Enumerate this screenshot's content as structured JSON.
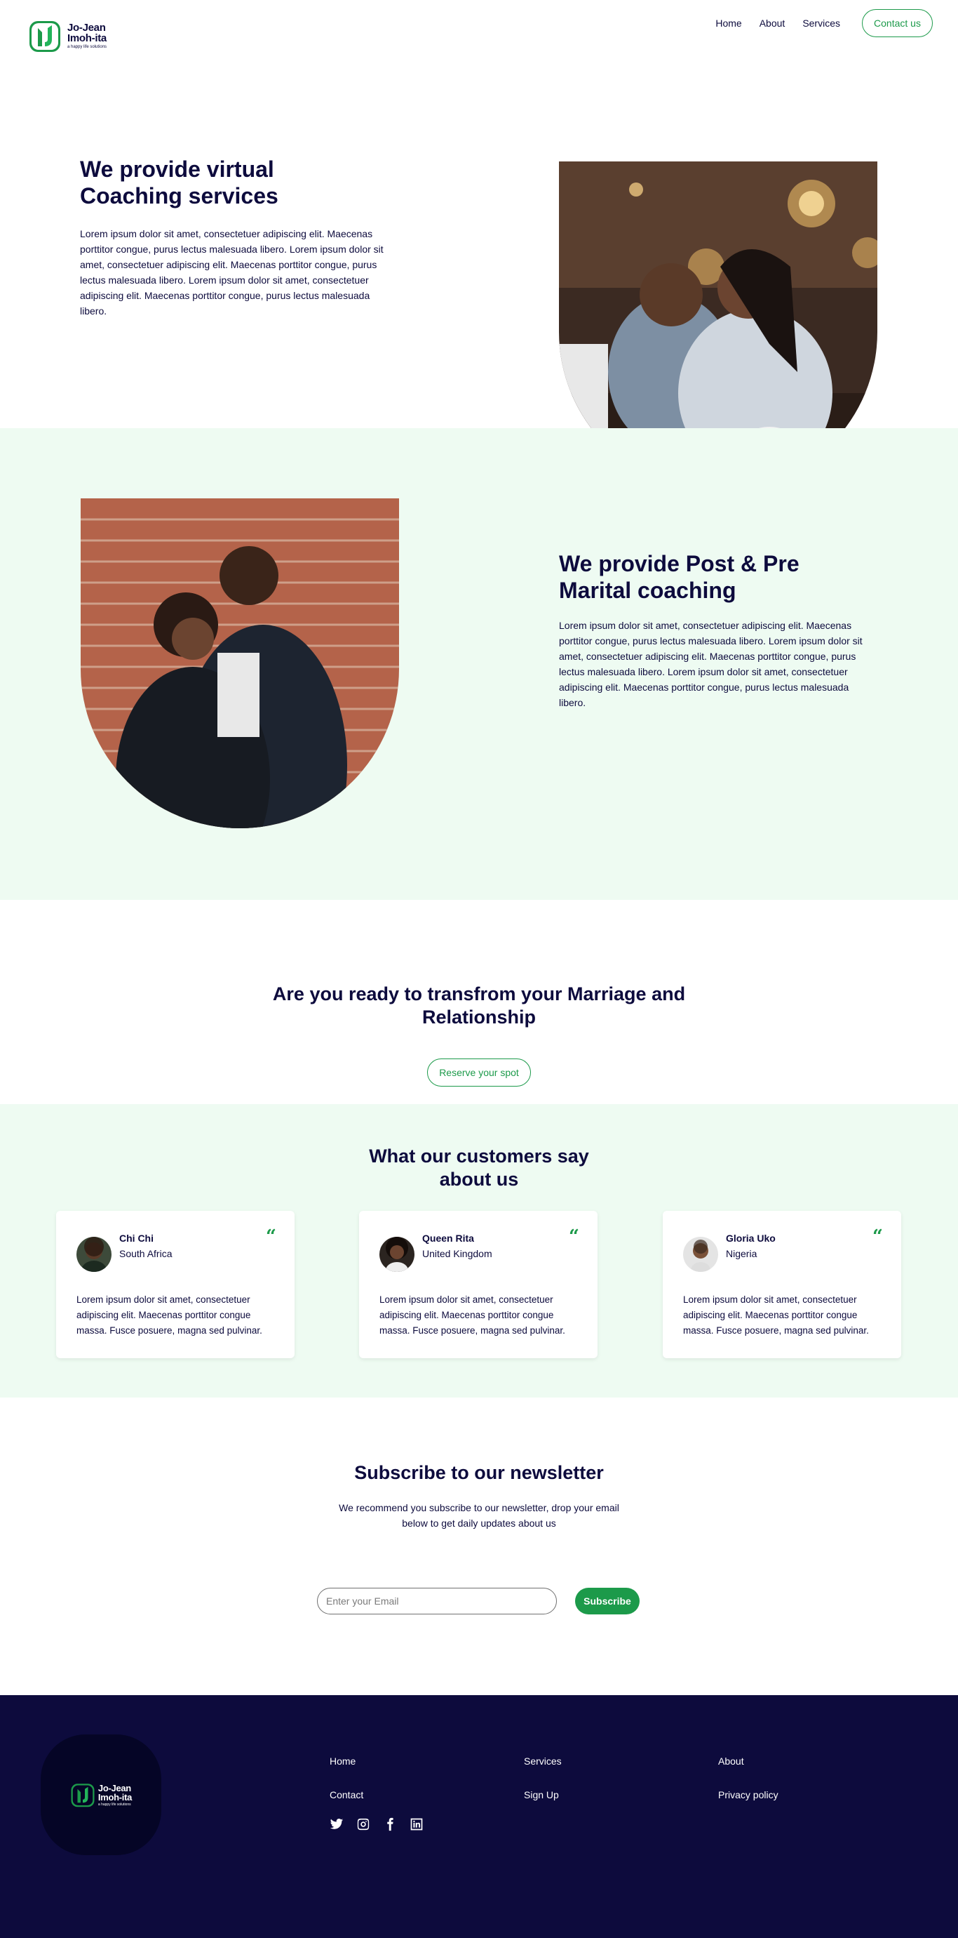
{
  "brand": {
    "name_line1": "Jo-Jean",
    "name_line2": "Imoh-ita",
    "tagline": "a happy life solutions"
  },
  "nav": {
    "items": [
      {
        "label": "Home"
      },
      {
        "label": "About"
      },
      {
        "label": "Services"
      }
    ],
    "contact_label": "Contact us"
  },
  "section1": {
    "title_line1": "We provide virtual",
    "title_line2": "Coaching services",
    "body": "Lorem ipsum dolor sit amet, consectetuer adipiscing elit. Maecenas porttitor congue, purus lectus malesuada libero. Lorem ipsum dolor sit amet, consectetuer adipiscing elit. Maecenas porttitor congue, purus lectus malesuada libero. Lorem ipsum dolor sit amet, consectetuer adipiscing elit. Maecenas porttitor congue, purus lectus malesuada libero."
  },
  "section2": {
    "title_line1": "We provide Post & Pre",
    "title_line2": "Marital coaching",
    "body": "Lorem ipsum dolor sit amet, consectetuer adipiscing elit. Maecenas porttitor congue, purus lectus malesuada libero. Lorem ipsum dolor sit amet, consectetuer adipiscing elit. Maecenas porttitor congue, purus lectus malesuada libero. Lorem ipsum dolor sit amet, consectetuer adipiscing elit. Maecenas porttitor congue, purus lectus malesuada libero."
  },
  "cta": {
    "title_line1": "Are you ready to transfrom your Marriage and",
    "title_line2": "Relationship",
    "button_label": "Reserve your spot"
  },
  "testimonials": {
    "title_line1": "What our customers say",
    "title_line2": "about us",
    "quote_glyph": "“",
    "items": [
      {
        "name": "Chi Chi",
        "location": "South Africa",
        "text": "Lorem ipsum dolor sit amet, consectetuer adipiscing elit. Maecenas porttitor congue massa. Fusce posuere, magna sed pulvinar."
      },
      {
        "name": "Queen Rita",
        "location": "United Kingdom",
        "text": "Lorem ipsum dolor sit amet, consectetuer adipiscing elit. Maecenas porttitor congue massa. Fusce posuere, magna sed pulvinar."
      },
      {
        "name": "Gloria Uko",
        "location": "Nigeria",
        "text": "Lorem ipsum dolor sit amet, consectetuer adipiscing elit. Maecenas porttitor congue massa. Fusce posuere, magna sed pulvinar."
      }
    ]
  },
  "newsletter": {
    "title": "Subscribe to our newsletter",
    "subtitle": "We recommend you subscribe to our newsletter, drop your email below to get daily updates about us",
    "input_placeholder": "Enter your Email",
    "button_label": "Subscribe"
  },
  "footer": {
    "links": [
      {
        "label": "Home"
      },
      {
        "label": "Services"
      },
      {
        "label": "About"
      },
      {
        "label": "Contact"
      },
      {
        "label": "Sign Up"
      },
      {
        "label": "Privacy policy"
      }
    ],
    "social_icons": [
      "twitter-icon",
      "instagram-icon",
      "facebook-icon",
      "linkedin-icon"
    ]
  },
  "colors": {
    "navy": "#0d0b3d",
    "green": "#1c9a4a",
    "mint_bg": "#eefbf2",
    "footer_bg": "#0d0b3d"
  }
}
